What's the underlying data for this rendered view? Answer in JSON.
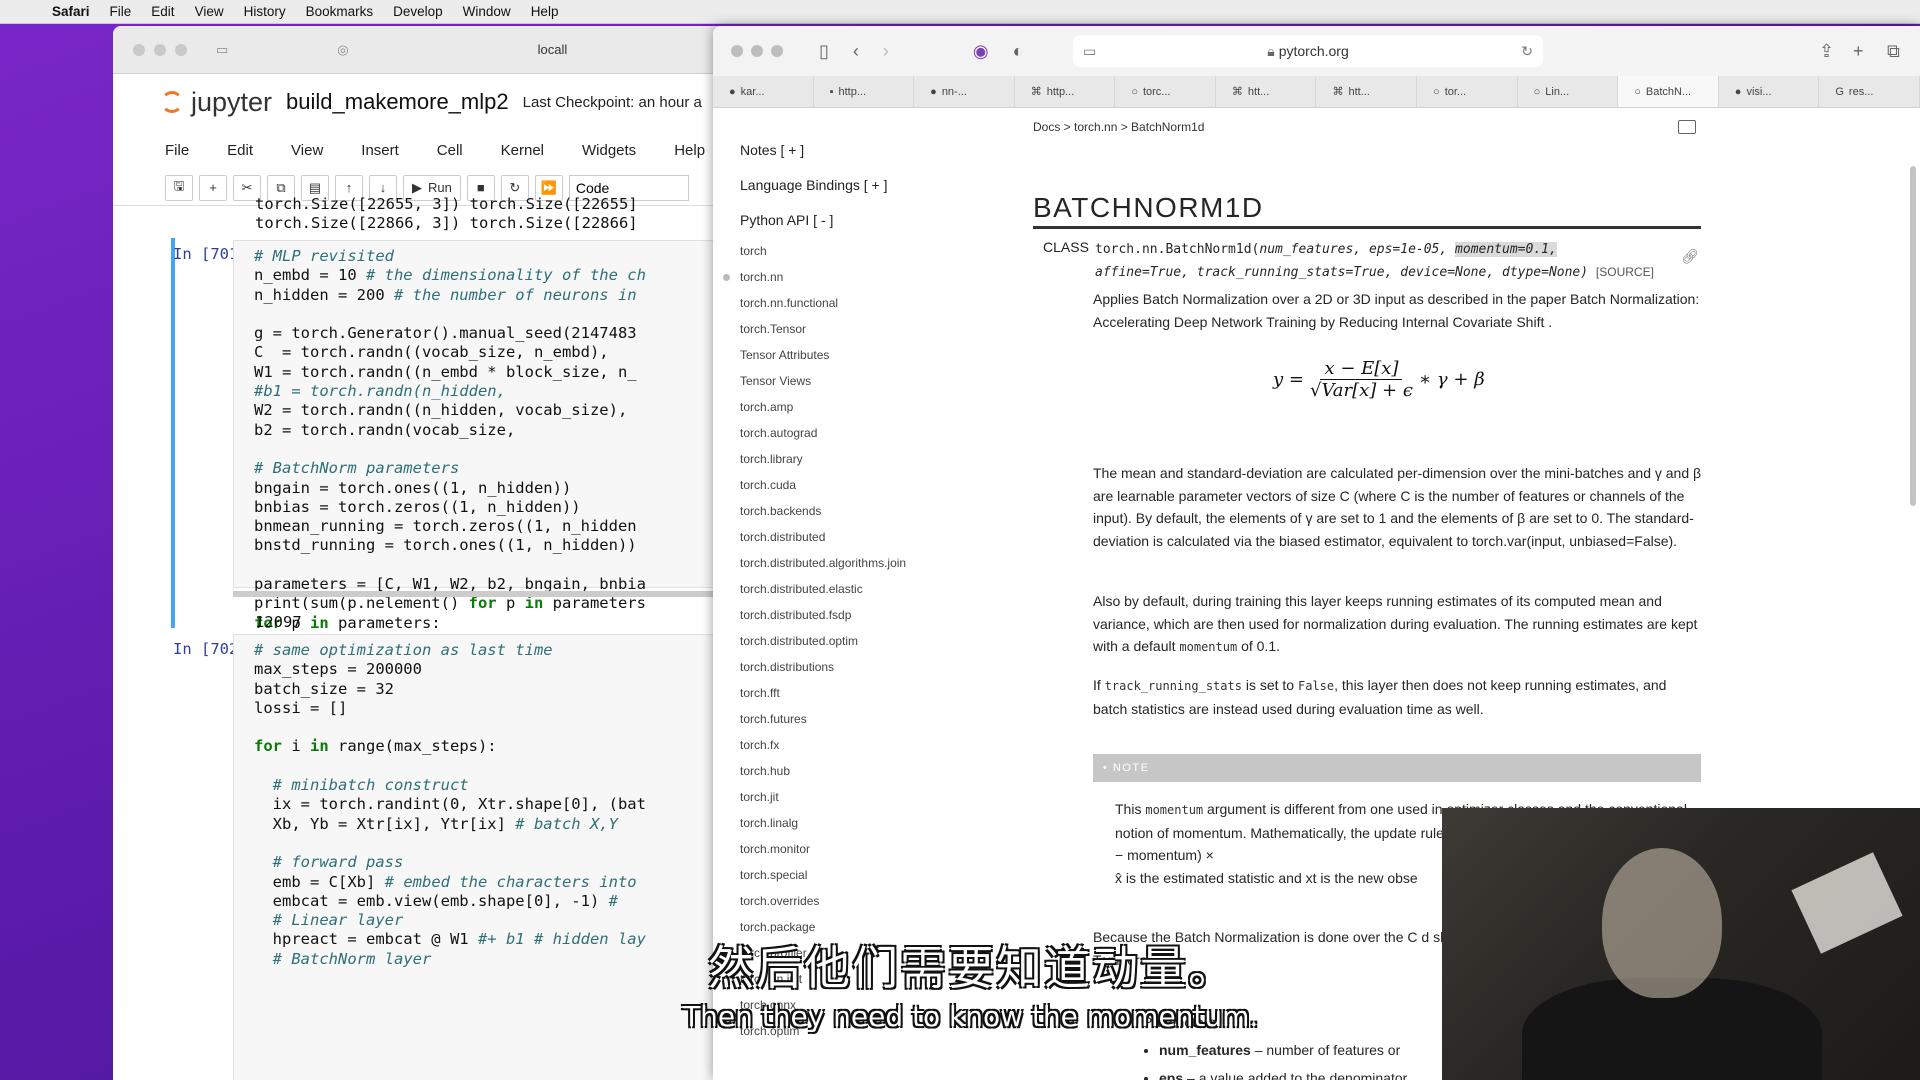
{
  "menubar": {
    "items": [
      "Safari",
      "File",
      "Edit",
      "View",
      "History",
      "Bookmarks",
      "Develop",
      "Window",
      "Help"
    ]
  },
  "jupyter": {
    "address_fragment": "locall",
    "logo_text": "jupyter",
    "notebook_title": "build_makemore_mlp2",
    "checkpoint": "Last Checkpoint: an hour a",
    "menu": [
      "File",
      "Edit",
      "View",
      "Insert",
      "Cell",
      "Kernel",
      "Widgets",
      "Help"
    ],
    "toolbar": {
      "run_label": "Run",
      "cell_type": "Code"
    },
    "top_output": [
      "torch.Size([22655, 3]) torch.Size([22655]",
      "torch.Size([22866, 3]) torch.Size([22866]"
    ],
    "cell1": {
      "prompt": "In [701]:",
      "output": "12097"
    },
    "cell2": {
      "prompt": "In [702]:"
    }
  },
  "safari": {
    "url": "pytorch.org",
    "tabs": [
      "kar...",
      "http...",
      "nn-...",
      "http...",
      "torc...",
      "htt...",
      "htt...",
      "tor...",
      "Lin...",
      "BatchN...",
      "visi...",
      "res..."
    ],
    "sidebar": {
      "notes": "Notes [ + ]",
      "bindings": "Language Bindings [ + ]",
      "python_api": "Python API [ - ]",
      "items": [
        "torch",
        "torch.nn",
        "torch.nn.functional",
        "torch.Tensor",
        "Tensor Attributes",
        "Tensor Views",
        "torch.amp",
        "torch.autograd",
        "torch.library",
        "torch.cuda",
        "torch.backends",
        "torch.distributed",
        "torch.distributed.algorithms.join",
        "torch.distributed.elastic",
        "torch.distributed.fsdp",
        "torch.distributed.optim",
        "torch.distributions",
        "torch.fft",
        "torch.futures",
        "torch.fx",
        "torch.hub",
        "torch.jit",
        "torch.linalg",
        "torch.monitor",
        "torch.special",
        "torch.overrides",
        "torch.package",
        "torch.profiler",
        "torch.nn.init",
        "torch.onnx",
        "torch.optim"
      ]
    },
    "doc": {
      "breadcrumb": "Docs > torch.nn > BatchNorm1d",
      "title": "BATCHNORM1D",
      "class_label": "CLASS",
      "sig_prefix": "torch.nn.BatchNorm1d(",
      "sig_p1": "num_features, eps=1e-05, ",
      "sig_p2": "momentum=0.1,",
      "sig_line2": "affine=True, track_running_stats=True, device=None, dtype=None)",
      "source": "[SOURCE]",
      "para1_a": "Applies Batch Normalization over a 2D or 3D input as described in the paper ",
      "para1_link": "Batch Normalization: Accelerating Deep Network Training by Reducing Internal Covariate Shift",
      "para1_b": " .",
      "formula_lhs": "y =",
      "formula_num": "x − E[x]",
      "formula_den": "√Var[x] + ϵ",
      "formula_rhs": "∗ γ + β",
      "para2": "The mean and standard-deviation are calculated per-dimension over the mini-batches and γ and β are learnable parameter vectors of size C (where C is the number of features or channels of the input). By default, the elements of γ are set to 1 and the elements of β are set to 0. The standard-deviation is calculated via the biased estimator, equivalent to torch.var(input, unbiased=False).",
      "para3_a": "Also by default, during training this layer keeps running estimates of its computed mean and variance, which are then used for normalization during evaluation. The running estimates are kept with a default ",
      "para3_code": "momentum",
      "para3_b": " of 0.1.",
      "para4_a": "If ",
      "para4_code1": "track_running_stats",
      "para4_b": " is set to ",
      "para4_code2": "False",
      "para4_c": ", this layer then does not keep running estimates, and batch statistics are instead used during evaluation time as well.",
      "note_label": "• NOTE",
      "note_a": "This ",
      "note_code": "momentum",
      "note_b": " argument is different from one used in optimizer classes and the conventional notion of momentum. Mathematically, the update rule for running statistics here is x̂new = (1 − momentum) × ",
      "note_c": "x̂ is the estimated statistic and xt is the new obse",
      "para5": "Because the Batch Normalization is done over the C d slices, it's common terminology to call this Temporal B",
      "params_title": "Parameters",
      "param1_name": "num_features",
      "param1_desc": " – number of features or",
      "param2_name": "eps",
      "param2_desc": " – a value added to the denominator"
    }
  },
  "subtitles": {
    "zh": "然后他们需要知道动量。",
    "en": "Then they need to know the momentum."
  }
}
